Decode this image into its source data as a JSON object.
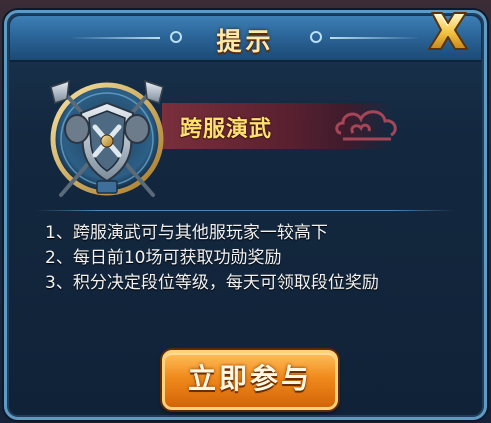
{
  "dialog": {
    "title": "提示",
    "close_icon": "close-x-icon"
  },
  "activity": {
    "name": "跨服演武",
    "emblem_icon": "crossed-axes-shield-emblem-icon",
    "ornament_icon": "cloud-ornament-icon"
  },
  "rules": [
    "1、跨服演武可与其他服玩家一较高下",
    "2、每日前10场可获取功勋奖励",
    "3、积分决定段位等级，每天可领取段位奖励"
  ],
  "actions": {
    "join_label": "立即参与"
  },
  "colors": {
    "title_bar": "#2a6396",
    "title_text": "#ffe9a8",
    "banner": "#7a2f3c",
    "banner_text": "#ffe070",
    "button": "#f08a1c",
    "panel": "#13283f"
  }
}
